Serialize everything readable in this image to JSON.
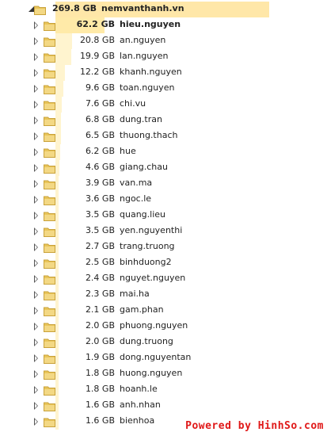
{
  "colors": {
    "bar": "#fff4cf",
    "bar_root": "#ffe7a8",
    "bar_selected": "#ffeaa8",
    "folder": "#e9c55a",
    "watermark": "#e01818"
  },
  "root": {
    "size": "269.8 GB",
    "name": "nemvanthanh.vn",
    "expanded": true,
    "fill_fraction": 1.0
  },
  "items": [
    {
      "size": "62.2 GB",
      "name": "hieu.nguyen",
      "fill_fraction": 0.2305,
      "selected": true
    },
    {
      "size": "20.8 GB",
      "name": "an.nguyen",
      "fill_fraction": 0.0771
    },
    {
      "size": "19.9 GB",
      "name": "lan.nguyen",
      "fill_fraction": 0.0738
    },
    {
      "size": "12.2 GB",
      "name": "khanh.nguyen",
      "fill_fraction": 0.0452
    },
    {
      "size": "9.6 GB",
      "name": "toan.nguyen",
      "fill_fraction": 0.0356
    },
    {
      "size": "7.6 GB",
      "name": "chi.vu",
      "fill_fraction": 0.0282
    },
    {
      "size": "6.8 GB",
      "name": "dung.tran",
      "fill_fraction": 0.0252
    },
    {
      "size": "6.5 GB",
      "name": "thuong.thach",
      "fill_fraction": 0.0241
    },
    {
      "size": "6.2 GB",
      "name": "hue",
      "fill_fraction": 0.023
    },
    {
      "size": "4.6 GB",
      "name": "giang.chau",
      "fill_fraction": 0.017
    },
    {
      "size": "3.9 GB",
      "name": "van.ma",
      "fill_fraction": 0.0145
    },
    {
      "size": "3.6 GB",
      "name": "ngoc.le",
      "fill_fraction": 0.0133
    },
    {
      "size": "3.5 GB",
      "name": "quang.lieu",
      "fill_fraction": 0.013
    },
    {
      "size": "3.5 GB",
      "name": "yen.nguyenthi",
      "fill_fraction": 0.013
    },
    {
      "size": "2.7 GB",
      "name": "trang.truong",
      "fill_fraction": 0.01
    },
    {
      "size": "2.5 GB",
      "name": "binhduong2",
      "fill_fraction": 0.0093
    },
    {
      "size": "2.4 GB",
      "name": "nguyet.nguyen",
      "fill_fraction": 0.0089
    },
    {
      "size": "2.3 GB",
      "name": "mai.ha",
      "fill_fraction": 0.0085
    },
    {
      "size": "2.1 GB",
      "name": "gam.phan",
      "fill_fraction": 0.0078
    },
    {
      "size": "2.0 GB",
      "name": "phuong.nguyen",
      "fill_fraction": 0.0074
    },
    {
      "size": "2.0 GB",
      "name": "dung.truong",
      "fill_fraction": 0.0074
    },
    {
      "size": "1.9 GB",
      "name": "dong.nguyentan",
      "fill_fraction": 0.007
    },
    {
      "size": "1.8 GB",
      "name": "huong.nguyen",
      "fill_fraction": 0.0067
    },
    {
      "size": "1.8 GB",
      "name": "hoanh.le",
      "fill_fraction": 0.0067
    },
    {
      "size": "1.6 GB",
      "name": "anh.nhan",
      "fill_fraction": 0.0059
    },
    {
      "size": "1.6 GB",
      "name": "bienhoa",
      "fill_fraction": 0.0059
    }
  ],
  "watermark": "Powered by HinhSo.com"
}
